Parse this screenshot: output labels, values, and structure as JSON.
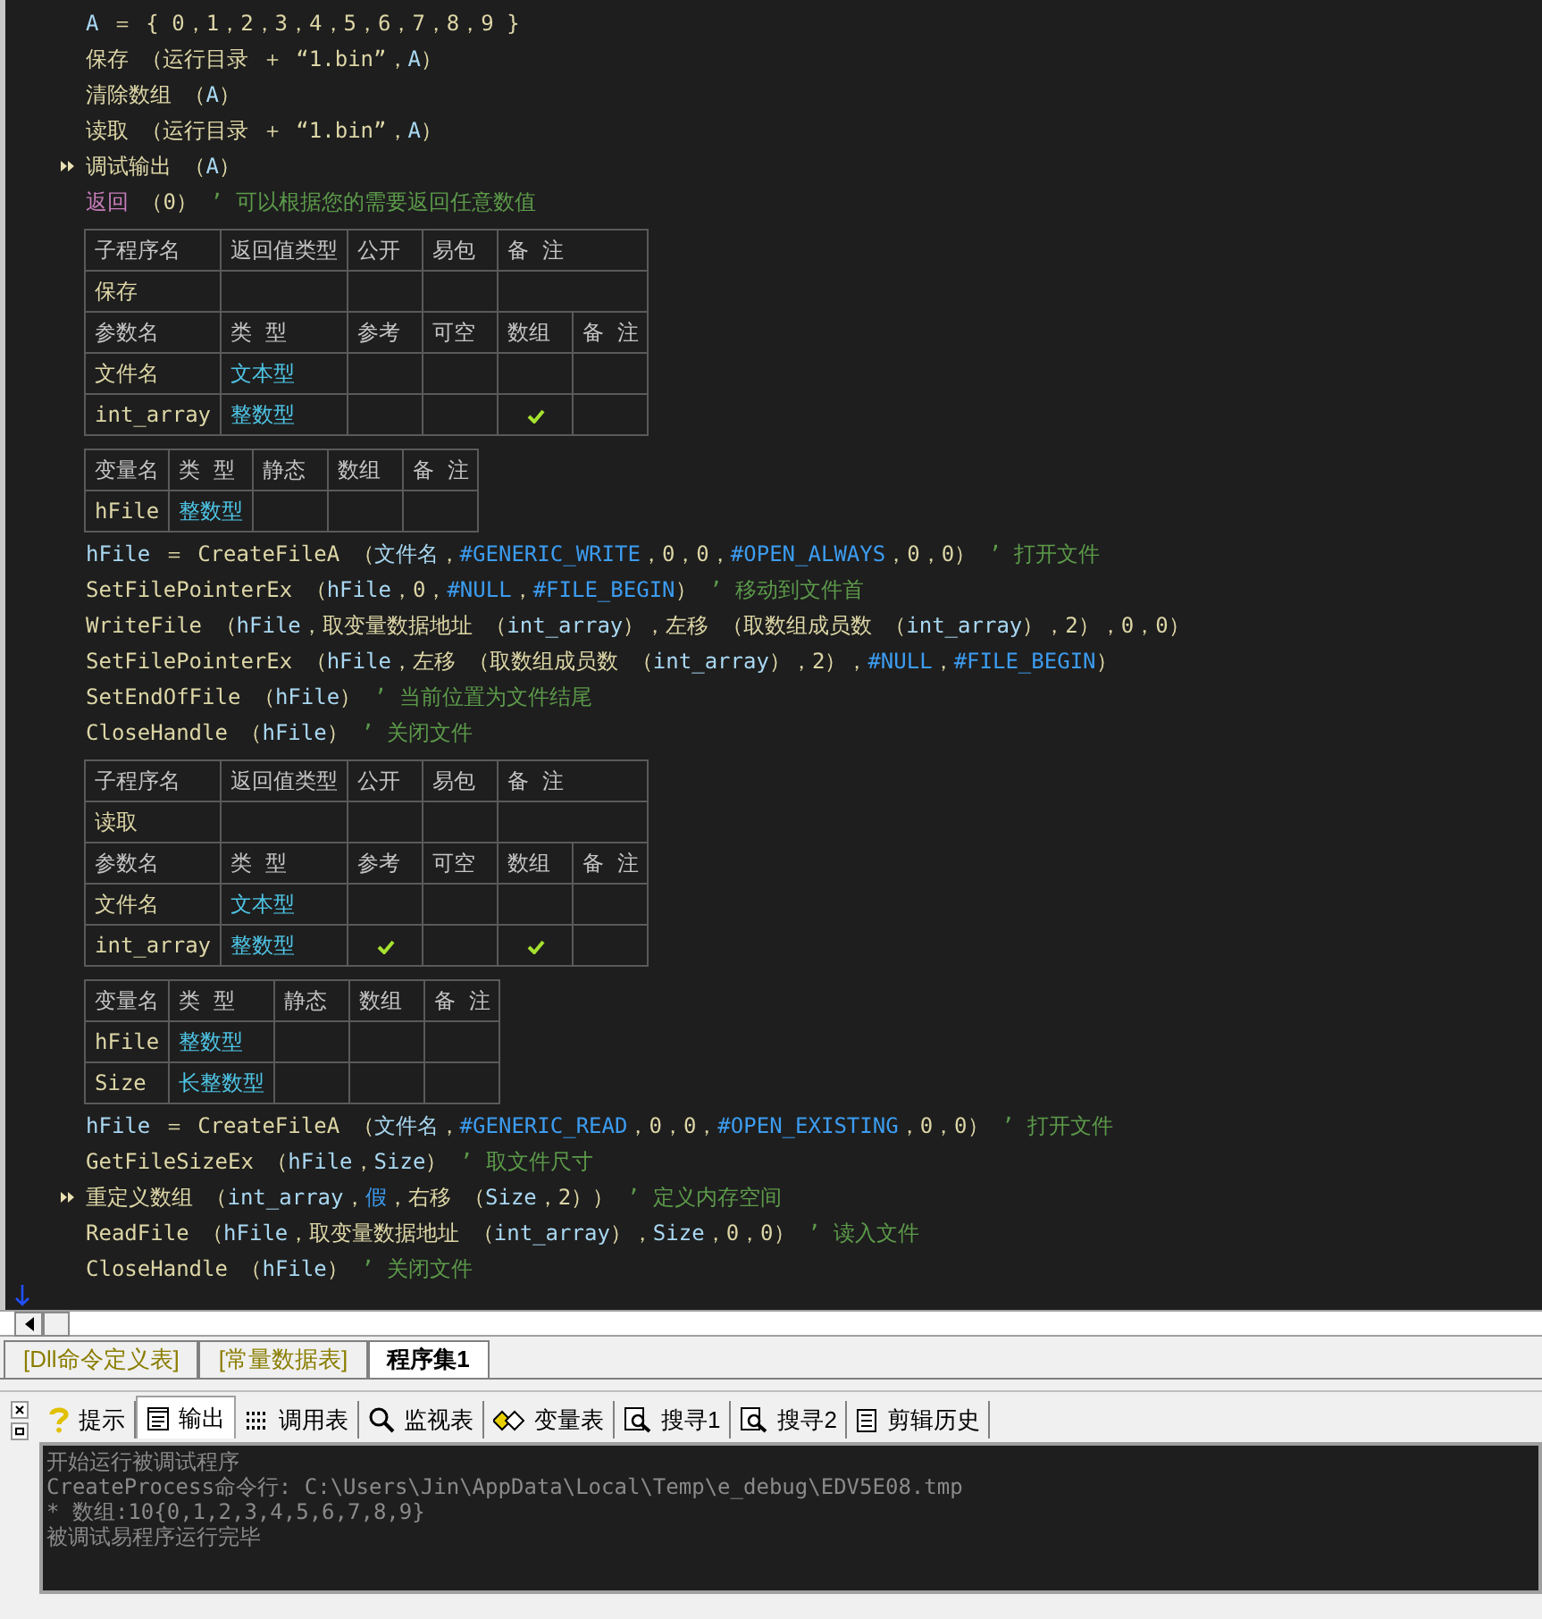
{
  "editor": {
    "blocks": [
      {
        "kind": "code",
        "lines": [
          {
            "marked": false,
            "segments": [
              {
                "kind": "var",
                "text": "A"
              },
              {
                "kind": "op",
                "text": " ＝ { 0，1，2，3，4，5，6，7，8，9 }"
              }
            ]
          },
          {
            "marked": false,
            "segments": [
              {
                "kind": "cmd",
                "text": "保存"
              },
              {
                "kind": "op",
                "text": " （"
              },
              {
                "kind": "cmd",
                "text": "运行目录"
              },
              {
                "kind": "op",
                "text": " ＋ “1.bin”，"
              },
              {
                "kind": "var",
                "text": "A"
              },
              {
                "kind": "op",
                "text": "）"
              }
            ]
          },
          {
            "marked": false,
            "segments": [
              {
                "kind": "cmd",
                "text": "清除数组"
              },
              {
                "kind": "op",
                "text": " （"
              },
              {
                "kind": "var",
                "text": "A"
              },
              {
                "kind": "op",
                "text": "）"
              }
            ]
          },
          {
            "marked": false,
            "segments": [
              {
                "kind": "cmd",
                "text": "读取"
              },
              {
                "kind": "op",
                "text": " （"
              },
              {
                "kind": "cmd",
                "text": "运行目录"
              },
              {
                "kind": "op",
                "text": " ＋ “1.bin”，"
              },
              {
                "kind": "var",
                "text": "A"
              },
              {
                "kind": "op",
                "text": "）"
              }
            ]
          },
          {
            "marked": true,
            "segments": [
              {
                "kind": "cmd",
                "text": "调试输出"
              },
              {
                "kind": "op",
                "text": " （"
              },
              {
                "kind": "var",
                "text": "A"
              },
              {
                "kind": "op",
                "text": "）"
              }
            ]
          },
          {
            "marked": false,
            "segments": [
              {
                "kind": "keyword",
                "text": "返回"
              },
              {
                "kind": "op",
                "text": " （0）"
              },
              {
                "kind": "comment",
                "text": " ’ 可以根据您的需要返回任意数值"
              }
            ]
          }
        ]
      },
      {
        "kind": "table",
        "rows": [
          [
            {
              "kind": "label",
              "text": "子程序名"
            },
            {
              "kind": "label",
              "text": "返回值类型"
            },
            {
              "kind": "label",
              "text": "公开"
            },
            {
              "kind": "label",
              "text": "易包"
            },
            {
              "kind": "label",
              "text": "备 注",
              "colspan": 2
            }
          ],
          [
            {
              "kind": "name",
              "text": "保存"
            },
            {
              "kind": "blank"
            },
            {
              "kind": "blank"
            },
            {
              "kind": "blank"
            },
            {
              "kind": "blank",
              "colspan": 2
            }
          ],
          [
            {
              "kind": "label",
              "text": "参数名"
            },
            {
              "kind": "label",
              "text": "类 型"
            },
            {
              "kind": "label",
              "text": "参考"
            },
            {
              "kind": "label",
              "text": "可空"
            },
            {
              "kind": "label",
              "text": "数组"
            },
            {
              "kind": "label",
              "text": "备 注"
            }
          ],
          [
            {
              "kind": "name",
              "text": "文件名"
            },
            {
              "kind": "type",
              "text": "文本型"
            },
            {
              "kind": "check",
              "checked": false
            },
            {
              "kind": "check",
              "checked": false
            },
            {
              "kind": "check",
              "checked": false
            },
            {
              "kind": "blank"
            }
          ],
          [
            {
              "kind": "name",
              "text": "int_array"
            },
            {
              "kind": "type",
              "text": "整数型"
            },
            {
              "kind": "check",
              "checked": false
            },
            {
              "kind": "check",
              "checked": false
            },
            {
              "kind": "check",
              "checked": true
            },
            {
              "kind": "blank"
            }
          ]
        ]
      },
      {
        "kind": "table",
        "rows": [
          [
            {
              "kind": "label",
              "text": "变量名"
            },
            {
              "kind": "label",
              "text": "类 型"
            },
            {
              "kind": "label",
              "text": "静态"
            },
            {
              "kind": "label",
              "text": "数组"
            },
            {
              "kind": "label",
              "text": "备 注"
            }
          ],
          [
            {
              "kind": "name",
              "text": "hFile"
            },
            {
              "kind": "type",
              "text": "整数型"
            },
            {
              "kind": "check",
              "checked": false
            },
            {
              "kind": "blank"
            },
            {
              "kind": "blank"
            }
          ]
        ]
      },
      {
        "kind": "code",
        "lines": [
          {
            "marked": false,
            "segments": [
              {
                "kind": "var",
                "text": "hFile"
              },
              {
                "kind": "op",
                "text": " ＝ "
              },
              {
                "kind": "cmd",
                "text": "CreateFileA"
              },
              {
                "kind": "op",
                "text": " （"
              },
              {
                "kind": "var",
                "text": "文件名"
              },
              {
                "kind": "op",
                "text": "，"
              },
              {
                "kind": "const",
                "text": "#GENERIC_WRITE"
              },
              {
                "kind": "op",
                "text": "，0，0，"
              },
              {
                "kind": "const",
                "text": "#OPEN_ALWAYS"
              },
              {
                "kind": "op",
                "text": "，0，0）"
              },
              {
                "kind": "comment",
                "text": " ’ 打开文件"
              }
            ]
          },
          {
            "marked": false,
            "segments": [
              {
                "kind": "cmd",
                "text": "SetFilePointerEx"
              },
              {
                "kind": "op",
                "text": " （"
              },
              {
                "kind": "var",
                "text": "hFile"
              },
              {
                "kind": "op",
                "text": "，0，"
              },
              {
                "kind": "const",
                "text": "#NULL"
              },
              {
                "kind": "op",
                "text": "，"
              },
              {
                "kind": "const",
                "text": "#FILE_BEGIN"
              },
              {
                "kind": "op",
                "text": "）"
              },
              {
                "kind": "comment",
                "text": " ’ 移动到文件首"
              }
            ]
          },
          {
            "marked": false,
            "segments": [
              {
                "kind": "cmd",
                "text": "WriteFile"
              },
              {
                "kind": "op",
                "text": " （"
              },
              {
                "kind": "var",
                "text": "hFile"
              },
              {
                "kind": "op",
                "text": "，"
              },
              {
                "kind": "cmd",
                "text": "取变量数据地址"
              },
              {
                "kind": "op",
                "text": " （"
              },
              {
                "kind": "var",
                "text": "int_array"
              },
              {
                "kind": "op",
                "text": "），"
              },
              {
                "kind": "cmd",
                "text": "左移"
              },
              {
                "kind": "op",
                "text": " （"
              },
              {
                "kind": "cmd",
                "text": "取数组成员数"
              },
              {
                "kind": "op",
                "text": " （"
              },
              {
                "kind": "var",
                "text": "int_array"
              },
              {
                "kind": "op",
                "text": "），2），0，0）"
              }
            ]
          },
          {
            "marked": false,
            "segments": [
              {
                "kind": "cmd",
                "text": "SetFilePointerEx"
              },
              {
                "kind": "op",
                "text": " （"
              },
              {
                "kind": "var",
                "text": "hFile"
              },
              {
                "kind": "op",
                "text": "，"
              },
              {
                "kind": "cmd",
                "text": "左移"
              },
              {
                "kind": "op",
                "text": " （"
              },
              {
                "kind": "cmd",
                "text": "取数组成员数"
              },
              {
                "kind": "op",
                "text": " （"
              },
              {
                "kind": "var",
                "text": "int_array"
              },
              {
                "kind": "op",
                "text": "），2），"
              },
              {
                "kind": "const",
                "text": "#NULL"
              },
              {
                "kind": "op",
                "text": "，"
              },
              {
                "kind": "const",
                "text": "#FILE_BEGIN"
              },
              {
                "kind": "op",
                "text": "）"
              }
            ]
          },
          {
            "marked": false,
            "segments": [
              {
                "kind": "cmd",
                "text": "SetEndOfFile"
              },
              {
                "kind": "op",
                "text": " （"
              },
              {
                "kind": "var",
                "text": "hFile"
              },
              {
                "kind": "op",
                "text": "）"
              },
              {
                "kind": "comment",
                "text": " ’ 当前位置为文件结尾"
              }
            ]
          },
          {
            "marked": false,
            "segments": [
              {
                "kind": "cmd",
                "text": "CloseHandle"
              },
              {
                "kind": "op",
                "text": " （"
              },
              {
                "kind": "var",
                "text": "hFile"
              },
              {
                "kind": "op",
                "text": "）"
              },
              {
                "kind": "comment",
                "text": " ’ 关闭文件"
              }
            ]
          }
        ]
      },
      {
        "kind": "table",
        "rows": [
          [
            {
              "kind": "label",
              "text": "子程序名"
            },
            {
              "kind": "label",
              "text": "返回值类型"
            },
            {
              "kind": "label",
              "text": "公开"
            },
            {
              "kind": "label",
              "text": "易包"
            },
            {
              "kind": "label",
              "text": "备 注",
              "colspan": 2
            }
          ],
          [
            {
              "kind": "name",
              "text": "读取"
            },
            {
              "kind": "blank"
            },
            {
              "kind": "blank"
            },
            {
              "kind": "blank"
            },
            {
              "kind": "blank",
              "colspan": 2
            }
          ],
          [
            {
              "kind": "label",
              "text": "参数名"
            },
            {
              "kind": "label",
              "text": "类 型"
            },
            {
              "kind": "label",
              "text": "参考"
            },
            {
              "kind": "label",
              "text": "可空"
            },
            {
              "kind": "label",
              "text": "数组"
            },
            {
              "kind": "label",
              "text": "备 注"
            }
          ],
          [
            {
              "kind": "name",
              "text": "文件名"
            },
            {
              "kind": "type",
              "text": "文本型"
            },
            {
              "kind": "check",
              "checked": false
            },
            {
              "kind": "check",
              "checked": false
            },
            {
              "kind": "check",
              "checked": false
            },
            {
              "kind": "blank"
            }
          ],
          [
            {
              "kind": "name",
              "text": "int_array"
            },
            {
              "kind": "type",
              "text": "整数型"
            },
            {
              "kind": "check",
              "checked": true
            },
            {
              "kind": "check",
              "checked": false
            },
            {
              "kind": "check",
              "checked": true
            },
            {
              "kind": "blank"
            }
          ]
        ]
      },
      {
        "kind": "table",
        "rows": [
          [
            {
              "kind": "label",
              "text": "变量名"
            },
            {
              "kind": "label",
              "text": "类 型"
            },
            {
              "kind": "label",
              "text": "静态"
            },
            {
              "kind": "label",
              "text": "数组"
            },
            {
              "kind": "label",
              "text": "备 注"
            }
          ],
          [
            {
              "kind": "name",
              "text": "hFile"
            },
            {
              "kind": "type",
              "text": "整数型"
            },
            {
              "kind": "check",
              "checked": false
            },
            {
              "kind": "blank"
            },
            {
              "kind": "blank"
            }
          ],
          [
            {
              "kind": "name",
              "text": "Size"
            },
            {
              "kind": "type",
              "text": "长整数型"
            },
            {
              "kind": "check",
              "checked": false
            },
            {
              "kind": "blank"
            },
            {
              "kind": "blank"
            }
          ]
        ]
      },
      {
        "kind": "code",
        "lines": [
          {
            "marked": false,
            "segments": [
              {
                "kind": "var",
                "text": "hFile"
              },
              {
                "kind": "op",
                "text": " ＝ "
              },
              {
                "kind": "cmd",
                "text": "CreateFileA"
              },
              {
                "kind": "op",
                "text": " （"
              },
              {
                "kind": "var",
                "text": "文件名"
              },
              {
                "kind": "op",
                "text": "，"
              },
              {
                "kind": "const",
                "text": "#GENERIC_READ"
              },
              {
                "kind": "op",
                "text": "，0，0，"
              },
              {
                "kind": "const",
                "text": "#OPEN_EXISTING"
              },
              {
                "kind": "op",
                "text": "，0，0）"
              },
              {
                "kind": "comment",
                "text": " ’ 打开文件"
              }
            ]
          },
          {
            "marked": false,
            "segments": [
              {
                "kind": "cmd",
                "text": "GetFileSizeEx"
              },
              {
                "kind": "op",
                "text": " （"
              },
              {
                "kind": "var",
                "text": "hFile"
              },
              {
                "kind": "op",
                "text": "，"
              },
              {
                "kind": "var",
                "text": "Size"
              },
              {
                "kind": "op",
                "text": "）"
              },
              {
                "kind": "comment",
                "text": " ’ 取文件尺寸"
              }
            ]
          },
          {
            "marked": true,
            "segments": [
              {
                "kind": "cmd",
                "text": "重定义数组"
              },
              {
                "kind": "op",
                "text": " （"
              },
              {
                "kind": "var",
                "text": "int_array"
              },
              {
                "kind": "op",
                "text": "，"
              },
              {
                "kind": "const",
                "text": "假"
              },
              {
                "kind": "op",
                "text": "，"
              },
              {
                "kind": "cmd",
                "text": "右移"
              },
              {
                "kind": "op",
                "text": " （"
              },
              {
                "kind": "var",
                "text": "Size"
              },
              {
                "kind": "op",
                "text": "，2））"
              },
              {
                "kind": "comment",
                "text": " ’ 定义内存空间"
              }
            ]
          },
          {
            "marked": false,
            "segments": [
              {
                "kind": "cmd",
                "text": "ReadFile"
              },
              {
                "kind": "op",
                "text": " （"
              },
              {
                "kind": "var",
                "text": "hFile"
              },
              {
                "kind": "op",
                "text": "，"
              },
              {
                "kind": "cmd",
                "text": "取变量数据地址"
              },
              {
                "kind": "op",
                "text": " （"
              },
              {
                "kind": "var",
                "text": "int_array"
              },
              {
                "kind": "op",
                "text": "），"
              },
              {
                "kind": "var",
                "text": "Size"
              },
              {
                "kind": "op",
                "text": "，0，0）"
              },
              {
                "kind": "comment",
                "text": " ’ 读入文件"
              }
            ]
          },
          {
            "marked": false,
            "segments": [
              {
                "kind": "cmd",
                "text": "CloseHandle"
              },
              {
                "kind": "op",
                "text": " （"
              },
              {
                "kind": "var",
                "text": "hFile"
              },
              {
                "kind": "op",
                "text": "）"
              },
              {
                "kind": "comment",
                "text": " ’ 关闭文件"
              }
            ]
          }
        ]
      }
    ]
  },
  "doc_tabs": [
    {
      "label": "[Dll命令定义表]",
      "selected": false
    },
    {
      "label": "[常量数据表]",
      "selected": false
    },
    {
      "label": "程序集1",
      "selected": true
    }
  ],
  "panel_tabs": [
    {
      "kind": "hint",
      "label": "提示",
      "selected": false
    },
    {
      "kind": "output",
      "label": "输出",
      "selected": true
    },
    {
      "kind": "calls",
      "label": "调用表",
      "selected": false
    },
    {
      "kind": "watch",
      "label": "监视表",
      "selected": false
    },
    {
      "kind": "vars",
      "label": "变量表",
      "selected": false
    },
    {
      "kind": "search",
      "label": "搜寻1",
      "selected": false
    },
    {
      "kind": "search",
      "label": "搜寻2",
      "selected": false
    },
    {
      "kind": "clip",
      "label": "剪辑历史",
      "selected": false
    }
  ],
  "output_lines": [
    "开始运行被调试程序",
    "CreateProcess命令行: C:\\Users\\Jin\\AppData\\Local\\Temp\\e_debug\\EDV5E08.tmp",
    "* 数组:10{0,1,2,3,4,5,6,7,8,9}",
    "被调试易程序运行完毕"
  ]
}
